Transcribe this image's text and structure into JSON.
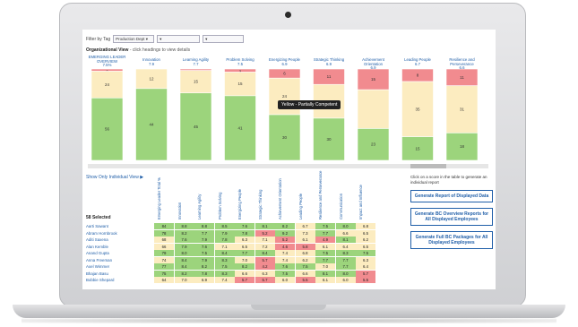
{
  "filter": {
    "label": "Filter by Tag",
    "selected": "Production Dept",
    "empty1": "",
    "empty2": ""
  },
  "org": {
    "title": "Organizational View",
    "subtitle": "- click headings to view details"
  },
  "chart_data": {
    "type": "bar",
    "stacked": true,
    "categories": [
      {
        "name": "EMERGING LEADER OVERVIEW",
        "score": "7.5%"
      },
      {
        "name": "Innovation",
        "score": "7.9"
      },
      {
        "name": "Learning Agility",
        "score": "7.7"
      },
      {
        "name": "Problem Solving",
        "score": "7.5"
      },
      {
        "name": "Energizing People",
        "score": "6.9"
      },
      {
        "name": "Strategic Thinking",
        "score": "6.9"
      },
      {
        "name": "Achievement Orientation",
        "score": "6.9"
      },
      {
        "name": "Leading People",
        "score": "6.7"
      },
      {
        "name": "Resilience and Perseverance",
        "score": "6.6"
      }
    ],
    "series": [
      {
        "name": "Red",
        "values": [
          2,
          0,
          1,
          2,
          6,
          11,
          15,
          8,
          11
        ],
        "color": "#f18b8f"
      },
      {
        "name": "Yellow",
        "values": [
          24,
          12,
          15,
          15,
          24,
          24,
          28,
          35,
          31
        ],
        "color": "#fcecc0"
      },
      {
        "name": "Green",
        "values": [
          56,
          44,
          45,
          41,
          30,
          30,
          23,
          15,
          18
        ],
        "color": "#9cd47c"
      }
    ],
    "labels_shown": [
      [
        "2",
        "24",
        "56"
      ],
      [
        "",
        "12",
        "44"
      ],
      [
        "1",
        "15",
        "45"
      ],
      [
        "2",
        "15",
        "41"
      ],
      [
        "6",
        "24",
        "30"
      ],
      [
        "11",
        "",
        "30"
      ],
      [
        "15",
        "",
        "23"
      ],
      [
        "8",
        "35",
        "15"
      ],
      [
        "11",
        "31",
        "18"
      ]
    ]
  },
  "tooltip": "Yellow - Partially Competent",
  "left": {
    "show_link": "Show Only Individual View ▶",
    "selected_count": "58 Selected"
  },
  "table": {
    "columns": [
      "Emerging Leader Total %",
      "Innovation",
      "Learning Agility",
      "Problem Solving",
      "Energizing People",
      "Strategic Thinking",
      "Achievement Orientation",
      "Leading People",
      "Resilience and Perseverance",
      "Communication",
      "Impact and Influence"
    ],
    "rows": [
      {
        "name": "Aarti Sawant",
        "values": [
          "84",
          "8.8",
          "8.8",
          "8.5",
          "7.6",
          "8.1",
          "8.2",
          "6.7",
          "7.5",
          "8.0",
          "6.8"
        ]
      },
      {
        "name": "Abram Hornbrook",
        "values": [
          "78",
          "8.2",
          "7.7",
          "7.9",
          "7.8",
          "5.2",
          "9.2",
          "7.3",
          "7.7",
          "6.6",
          "6.5"
        ]
      },
      {
        "name": "Aditi Saxena",
        "values": [
          "68",
          "7.6",
          "7.9",
          "7.8",
          "6.3",
          "7.1",
          "5.2",
          "6.1",
          "4.9",
          "8.1",
          "6.2"
        ]
      },
      {
        "name": "Alan Kemble",
        "values": [
          "66",
          "7.9",
          "7.6",
          "7.1",
          "6.5",
          "7.2",
          "4.6",
          "5.8",
          "6.1",
          "6.4",
          "6.5"
        ]
      },
      {
        "name": "Anand Gupta",
        "values": [
          "79",
          "8.0",
          "7.5",
          "8.4",
          "7.7",
          "8.4",
          "7.4",
          "6.8",
          "7.5",
          "8.3",
          "7.5"
        ]
      },
      {
        "name": "Anna Freeman",
        "values": [
          "74",
          "8.4",
          "7.9",
          "8.3",
          "7.0",
          "5.7",
          "7.4",
          "6.2",
          "7.7",
          "7.7",
          "6.3"
        ]
      },
      {
        "name": "Axel Wimmer",
        "values": [
          "77",
          "8.4",
          "8.2",
          "7.5",
          "8.2",
          "4.2",
          "7.6",
          "7.5",
          "7.0",
          "7.7",
          "6.4"
        ]
      },
      {
        "name": "Bhajan Basu",
        "values": [
          "75",
          "8.2",
          "7.8",
          "8.3",
          "6.6",
          "6.3",
          "7.5",
          "6.6",
          "8.1",
          "8.0",
          "5.7"
        ]
      },
      {
        "name": "Bobbie Shepard",
        "values": [
          "64",
          "7.0",
          "6.9",
          "7.4",
          "5.7",
          "5.7",
          "6.0",
          "5.5",
          "6.1",
          "6.0",
          "5.5"
        ]
      }
    ]
  },
  "right": {
    "hint": "Click on a score in the table to generate an individual report",
    "btn1": "Generate Report of Displayed Data",
    "btn2": "Generate BC Overview Reports for All Displayed Employees",
    "btn3": "Generate Full BC Packages for All Displayed Employees"
  }
}
